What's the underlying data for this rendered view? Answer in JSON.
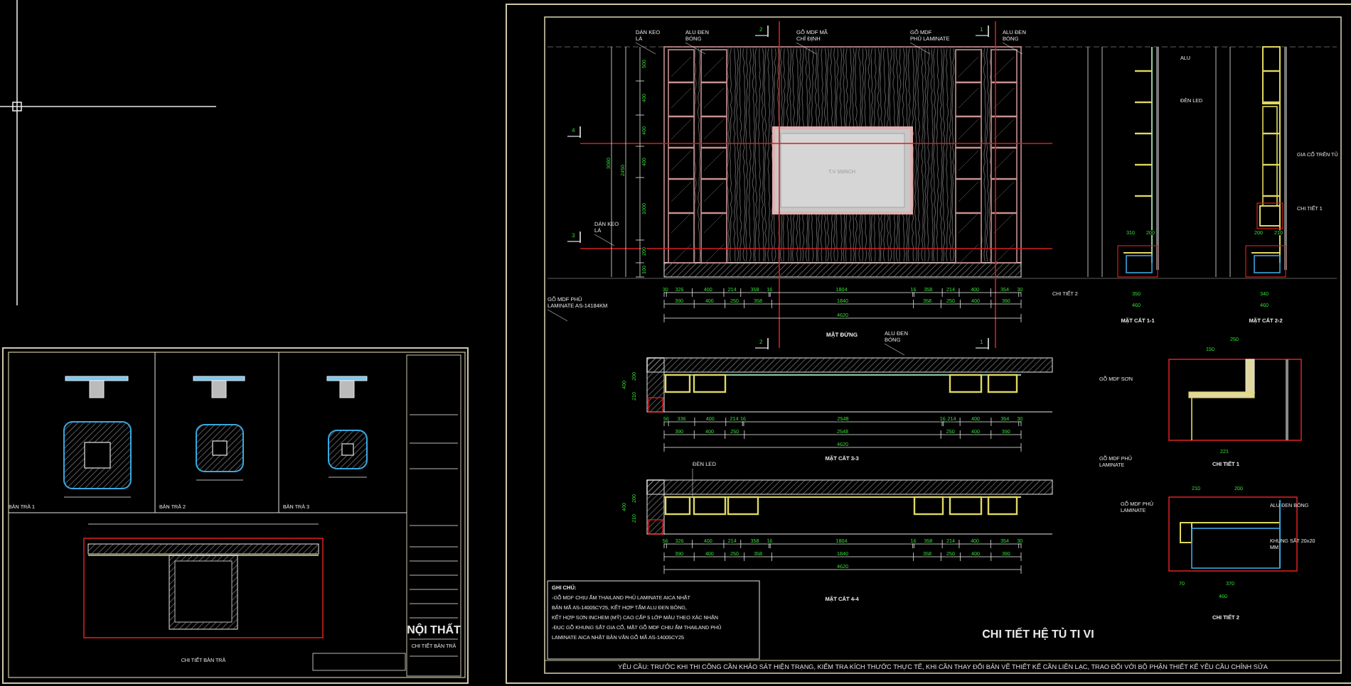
{
  "left_sheet": {
    "views": [
      {
        "label": "BÀN TRÀ 1"
      },
      {
        "label": "BÀN TRÀ 2"
      },
      {
        "label": "BÀN TRÀ 3"
      }
    ],
    "detail_label": "CHI TIẾT BÀN TRÀ",
    "title_block": {
      "company": "NỘI THẤT",
      "drawing_name": "CHI TIẾT BÀN TRÀ"
    }
  },
  "main_sheet": {
    "elevation": {
      "callouts": [
        "DÁN KEO LÁ",
        "ALU ĐEN BÓNG",
        "GỖ MDF MÃ CHỈ ĐỊNH",
        "GỖ MDF PHỦ LAMINATE",
        "ALU ĐEN BÓNG",
        "DÁN KEO LÁ",
        "GỖ MDF PHỦ LAMINATE AS-14184KM",
        "ALU ĐEN BÓNG"
      ],
      "tv_label": "T.V 55INCH",
      "section_marks": [
        "2",
        "1",
        "4",
        "3",
        "2",
        "1"
      ],
      "vertical_dims": [
        "500",
        "400",
        "400",
        "400",
        "1000",
        "200",
        "100"
      ],
      "overall_heights": [
        "3080",
        "2450"
      ],
      "dims_row_1": [
        "30",
        "326",
        "400",
        "214",
        "358",
        "16",
        "1804",
        "16",
        "358",
        "214",
        "400",
        "354",
        "30"
      ],
      "dims_row_2": [
        "390",
        "400",
        "250",
        "358",
        "1840",
        "358",
        "250",
        "400",
        "390"
      ],
      "total": "4620",
      "title": "MẶT ĐỨNG"
    },
    "sections": [
      {
        "title": "MẶT CẮT 1-1",
        "callouts": [
          "ALU",
          "ĐÈN LED",
          "CHI TIẾT 2"
        ],
        "dims": [
          "310",
          "200",
          "350",
          "460"
        ]
      },
      {
        "title": "MẶT CẮT 2-2",
        "callouts": [
          "GIA CỐ TRÊN TỦ",
          "CHI TIẾT 1"
        ],
        "dims": [
          "200",
          "210",
          "340",
          "460"
        ]
      }
    ],
    "plans": [
      {
        "title": "MẶT CẮT 3-3",
        "depths": [
          "400",
          "200",
          "210"
        ],
        "dims_row_1": [
          "56",
          "336",
          "400",
          "214",
          "16",
          "2548",
          "16",
          "214",
          "400",
          "354",
          "30"
        ],
        "dims_row_2": [
          "390",
          "400",
          "250",
          "2548",
          "250",
          "400",
          "390"
        ],
        "total": "4620"
      },
      {
        "title": "MẶT CẮT 4-4",
        "callout": "ĐÈN LED",
        "depths": [
          "400",
          "200",
          "210"
        ],
        "dims_row_1": [
          "56",
          "326",
          "400",
          "214",
          "358",
          "16",
          "1804",
          "16",
          "358",
          "214",
          "400",
          "354",
          "30"
        ],
        "dims_row_2": [
          "390",
          "400",
          "250",
          "358",
          "1840",
          "358",
          "250",
          "400",
          "390"
        ],
        "total": "4620"
      }
    ],
    "details": [
      {
        "title": "CHI TIẾT 1",
        "callouts": [
          "GỖ MDF SƠN",
          "GỖ MDF PHỦ LAMINATE"
        ],
        "dims": [
          "250",
          "150",
          "221"
        ]
      },
      {
        "title": "CHI TIẾT 2",
        "callouts": [
          "GỖ MDF PHỦ LAMINATE",
          "ALU ĐEN BÓNG",
          "KHUNG SẮT 20x20 MM"
        ],
        "dims": [
          "210",
          "200",
          "70",
          "370",
          "460"
        ]
      }
    ],
    "notes": {
      "heading": "GHI CHÚ:",
      "lines": [
        "-GỖ MDF CHỊU ẨM THAILAND PHỦ LAMINATE AICA NHẬT",
        "BẢN MÃ AS-14005CY25, KẾT HỢP TẤM ALU ĐEN BÓNG,",
        "KẾT HỢP SƠN INCHEM (MỸ) CAO CẤP 5 LỚP MÀU THEO XÁC NHẬN",
        "-ĐỤC GỖ KHUNG SẮT GIA CỐ, MẶT GỖ MDF CHỊU ẨM THAILAND PHỦ",
        "LAMINATE AICA NHẬT BẢN VÂN GỖ MÃ AS-14005CY25"
      ]
    },
    "sheet_title": "CHI TIẾT HỆ TỦ TI VI",
    "footer_note": "YÊU CẦU: TRƯỚC KHI THI CÔNG CẦN KHẢO SÁT HIỆN TRẠNG, KIỂM TRA KÍCH THƯỚC THỰC TẾ, KHI CẦN THAY ĐỔI BẢN VẼ THIẾT KẾ CẦN LIÊN LẠC, TRAO ĐỔI VỚI BỘ PHẬN THIẾT KẾ YÊU CẦU CHỈNH SỬA"
  }
}
